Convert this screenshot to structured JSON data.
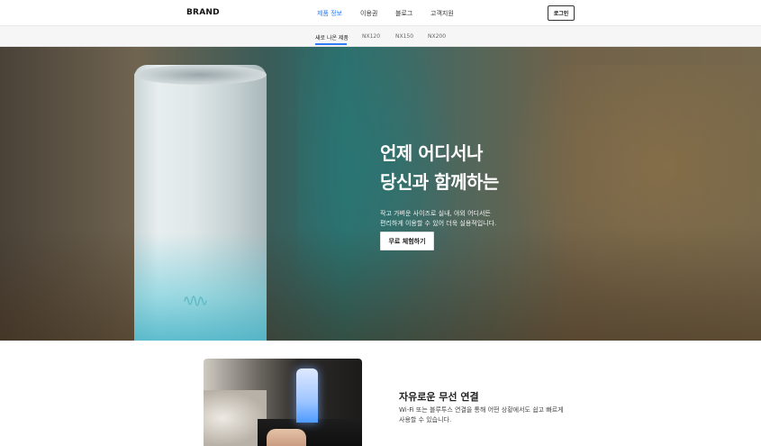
{
  "header": {
    "brand": "BRAND",
    "nav": [
      {
        "label": "제품 정보",
        "active": true
      },
      {
        "label": "이용권",
        "active": false
      },
      {
        "label": "블로그",
        "active": false
      },
      {
        "label": "고객지원",
        "active": false
      }
    ],
    "login_label": "로그인"
  },
  "subnav": {
    "tabs": [
      {
        "label": "새로 나온 제품",
        "active": true
      },
      {
        "label": "NX120",
        "active": false
      },
      {
        "label": "NX150",
        "active": false
      },
      {
        "label": "NX200",
        "active": false
      }
    ]
  },
  "hero": {
    "title_line1": "언제 어디서나",
    "title_line2": "당신과 함께하는",
    "desc_line1": "작고 가벼운 사이즈로 실내, 야외 어디서든",
    "desc_line2": "편리하게 이용할 수 있어 더욱 실용적입니다.",
    "cta_label": "무료 체험하기",
    "icon": "sound-wave-icon"
  },
  "feature": {
    "title": "자유로운 무선 연결",
    "desc_line1": "Wi-Fi 또는 블루투스 연결을 통해 어떤 상황에서도 쉽고 빠르게",
    "desc_line2": "사용할 수 있습니다."
  },
  "colors": {
    "accent": "#2f7cf6",
    "text": "#222222",
    "subnav_bg": "#f6f6f6"
  }
}
